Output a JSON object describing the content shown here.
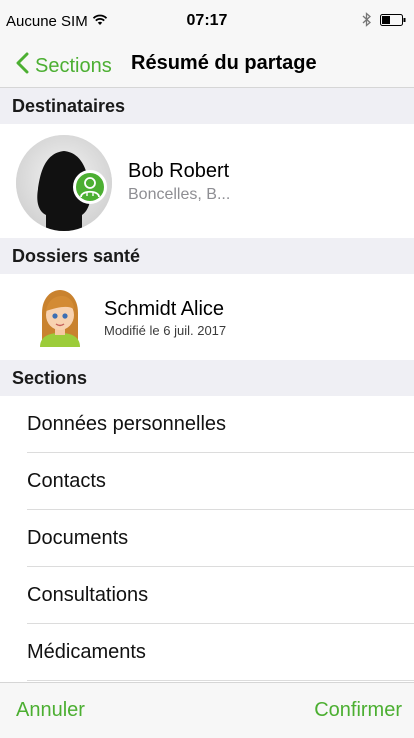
{
  "status_bar": {
    "carrier": "Aucune SIM",
    "time": "07:17",
    "icons": [
      "wifi-icon",
      "bluetooth-icon",
      "battery-icon"
    ]
  },
  "nav": {
    "back_label": "Sections",
    "title": "Résumé du partage"
  },
  "recipients": {
    "header": "Destinataires",
    "items": [
      {
        "name": "Bob Robert",
        "subtitle": "Boncelles, B..."
      }
    ]
  },
  "health_records": {
    "header": "Dossiers santé",
    "items": [
      {
        "name": "Schmidt Alice",
        "subtitle": "Modifié le 6 juil. 2017"
      }
    ]
  },
  "sections": {
    "header": "Sections",
    "items": [
      {
        "label": "Données personnelles"
      },
      {
        "label": "Contacts"
      },
      {
        "label": "Documents"
      },
      {
        "label": "Consultations"
      },
      {
        "label": "Médicaments"
      }
    ]
  },
  "toolbar": {
    "cancel_label": "Annuler",
    "confirm_label": "Confirmer"
  },
  "colors": {
    "accent": "#4caf32",
    "section_header_bg": "#efeff4",
    "bar_bg": "#f7f7f7"
  }
}
